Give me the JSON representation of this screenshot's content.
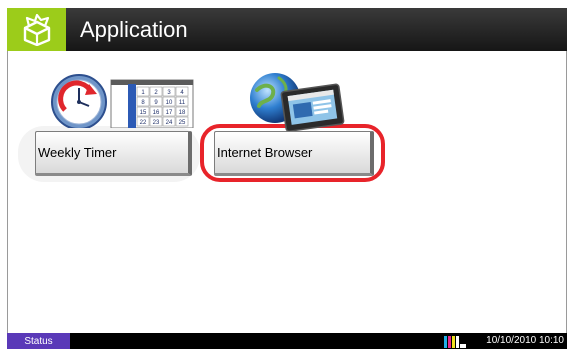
{
  "header": {
    "title": "Application"
  },
  "apps": [
    {
      "label": "Weekly Timer",
      "icon": "weekly-timer-icon"
    },
    {
      "label": "Internet Browser",
      "icon": "internet-browser-icon"
    }
  ],
  "calendar_numbers": [
    "1",
    "2",
    "3",
    "4",
    "8",
    "9",
    "10",
    "11",
    "15",
    "16",
    "17",
    "18",
    "22",
    "23",
    "24",
    "25"
  ],
  "statusbar": {
    "status_label": "Status",
    "datetime": "10/10/2010  10:10"
  },
  "colors": {
    "header_bg": "#1f1f1f",
    "logo_bg": "#9ccc1a",
    "highlight": "#e8242a",
    "status_button": "#5a39b8"
  }
}
